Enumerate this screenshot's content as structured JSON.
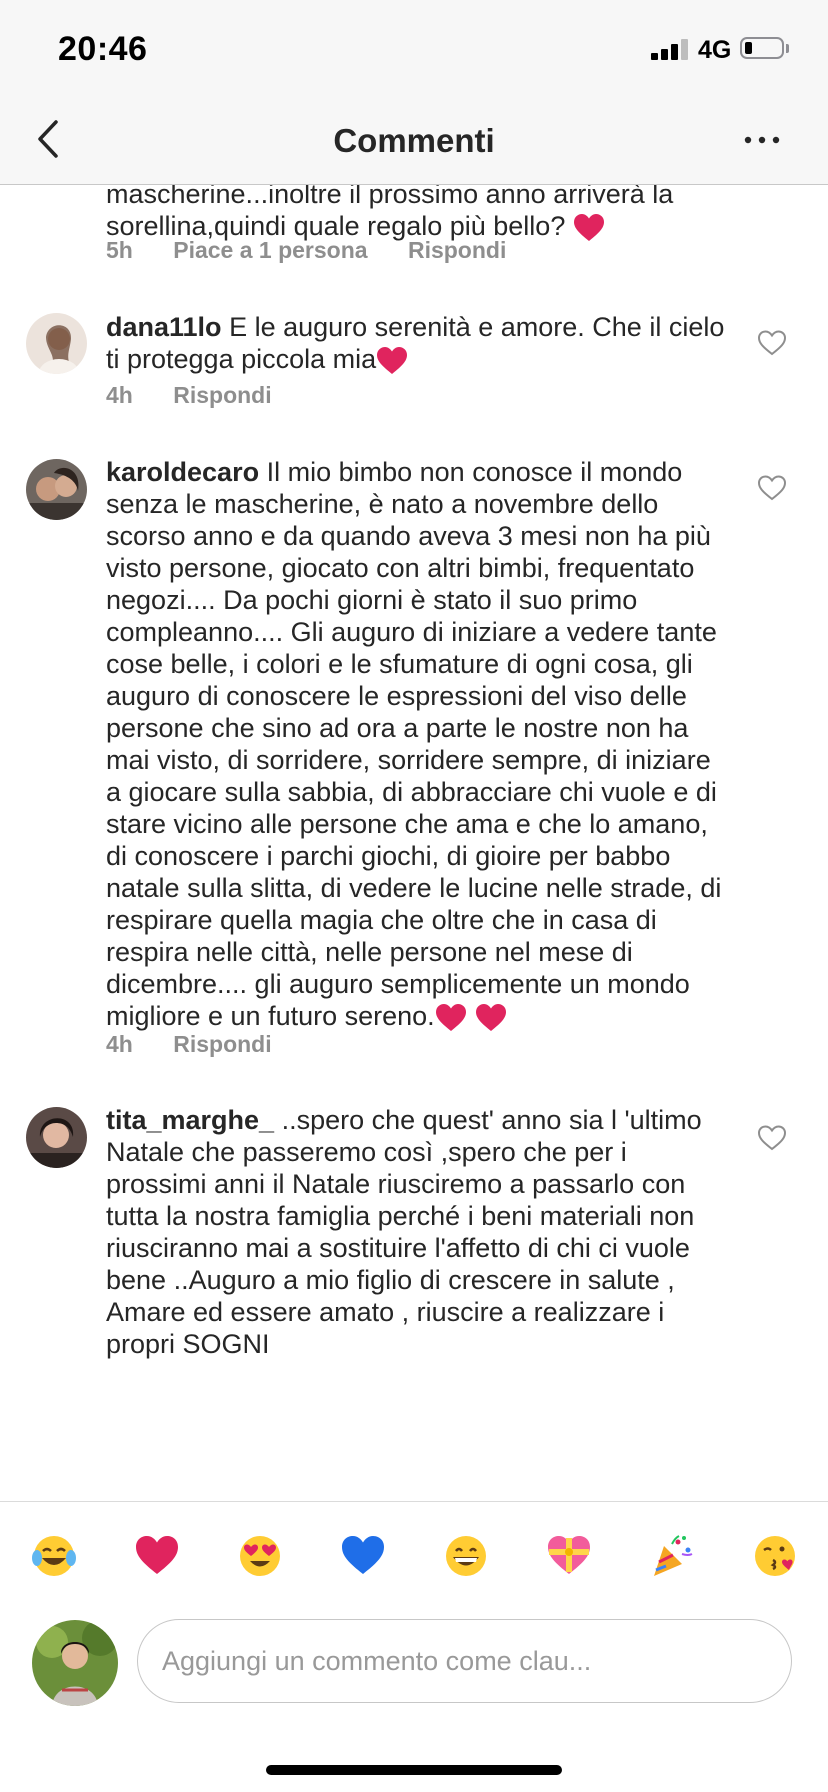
{
  "status": {
    "time": "20:46",
    "network": "4G",
    "battery_percent": 20
  },
  "nav": {
    "title": "Commenti"
  },
  "comments": [
    {
      "username": "",
      "text": "mascherine...inoltre il prossimo anno arriverà la sorellina,quindi quale regalo più bello?",
      "time": "5h",
      "likes": "Piace a 1 persona",
      "reply": "Rispondi"
    },
    {
      "username": "dana11lo",
      "text": "E le auguro serenità e amore. Che il cielo ti protegga piccola mia",
      "time": "4h",
      "reply": "Rispondi"
    },
    {
      "username": "karoldecaro",
      "text": "Il mio bimbo non conosce il mondo senza le mascherine, è nato a novembre dello scorso anno e da quando aveva 3 mesi non ha più visto persone, giocato con altri bimbi, frequentato negozi.... Da pochi giorni è stato il suo primo compleanno.... Gli auguro di iniziare a vedere tante cose belle, i colori e le sfumature di ogni cosa, gli auguro di conoscere le espressioni del viso delle persone che sino ad ora a parte le nostre non ha mai visto, di sorridere, sorridere sempre, di iniziare a giocare sulla sabbia, di abbracciare chi vuole e di stare vicino alle persone che ama e che lo amano, di conoscere i parchi giochi, di gioire per babbo natale sulla slitta, di vedere le lucine nelle strade, di respirare quella magia che oltre che in casa di respira nelle città, nelle persone nel mese di dicembre.... gli auguro semplicemente un mondo migliore e un futuro sereno.",
      "time": "4h",
      "reply": "Rispondi"
    },
    {
      "username": "tita_marghe_",
      "text": "..spero che  quest' anno sia l 'ultimo Natale che passeremo così ,spero che per i prossimi anni il Natale riusciremo a passarlo con tutta la nostra famiglia perché i beni materiali non riusciranno mai a sostituire l'affetto di chi ci vuole bene ..Auguro a mio figlio di crescere in salute , Amare ed essere amato , riuscire a realizzare i propri SOGNI"
    }
  ],
  "emoji_bar": [
    "face-with-tears-of-joy",
    "red-heart",
    "heart-eyes",
    "blue-heart",
    "grinning-face",
    "heart-with-ribbon",
    "party-popper",
    "face-blowing-kiss"
  ],
  "compose": {
    "placeholder": "Aggiungi un commento come clau..."
  },
  "colors": {
    "text": "#262626",
    "meta": "#8e8e8e",
    "heart": "#e0245e",
    "bar": "#f7f7f7"
  }
}
